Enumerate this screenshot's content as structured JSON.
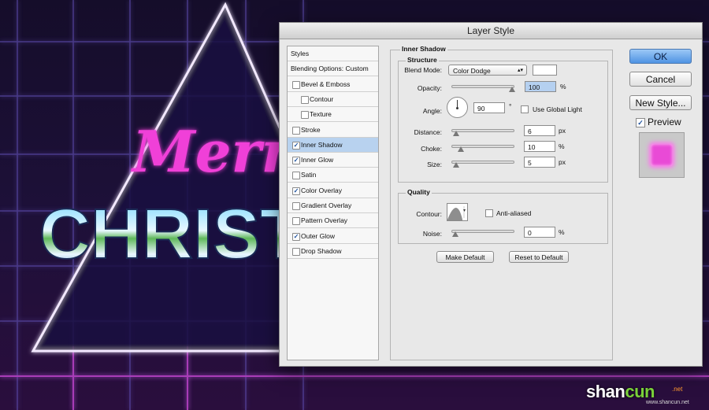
{
  "background_art": {
    "line1": "Merr",
    "line2": "CHRISTI"
  },
  "dialog": {
    "title": "Layer Style",
    "styles_list": [
      {
        "label": "Styles",
        "checkbox": false,
        "checked": false,
        "indent": 0,
        "selected": false
      },
      {
        "label": "Blending Options: Custom",
        "checkbox": false,
        "checked": false,
        "indent": 0,
        "selected": false
      },
      {
        "label": "Bevel & Emboss",
        "checkbox": true,
        "checked": false,
        "indent": 0,
        "selected": false
      },
      {
        "label": "Contour",
        "checkbox": true,
        "checked": false,
        "indent": 1,
        "selected": false
      },
      {
        "label": "Texture",
        "checkbox": true,
        "checked": false,
        "indent": 1,
        "selected": false
      },
      {
        "label": "Stroke",
        "checkbox": true,
        "checked": false,
        "indent": 0,
        "selected": false
      },
      {
        "label": "Inner Shadow",
        "checkbox": true,
        "checked": true,
        "indent": 0,
        "selected": true
      },
      {
        "label": "Inner Glow",
        "checkbox": true,
        "checked": true,
        "indent": 0,
        "selected": false
      },
      {
        "label": "Satin",
        "checkbox": true,
        "checked": false,
        "indent": 0,
        "selected": false
      },
      {
        "label": "Color Overlay",
        "checkbox": true,
        "checked": true,
        "indent": 0,
        "selected": false
      },
      {
        "label": "Gradient Overlay",
        "checkbox": true,
        "checked": false,
        "indent": 0,
        "selected": false
      },
      {
        "label": "Pattern Overlay",
        "checkbox": true,
        "checked": false,
        "indent": 0,
        "selected": false
      },
      {
        "label": "Outer Glow",
        "checkbox": true,
        "checked": true,
        "indent": 0,
        "selected": false
      },
      {
        "label": "Drop Shadow",
        "checkbox": true,
        "checked": false,
        "indent": 0,
        "selected": false
      }
    ],
    "panel": {
      "title": "Inner Shadow",
      "structure": {
        "title": "Structure",
        "blend_mode_label": "Blend Mode:",
        "blend_mode_value": "Color Dodge",
        "blend_color": "#ffffff",
        "opacity_label": "Opacity:",
        "opacity_value": "100",
        "opacity_unit": "%",
        "opacity_fraction": 1.0,
        "angle_label": "Angle:",
        "angle_value": "90",
        "angle_unit": "°",
        "use_global_light_label": "Use Global Light",
        "distance_label": "Distance:",
        "distance_value": "6",
        "distance_unit": "px",
        "distance_fraction": 0.02,
        "choke_label": "Choke:",
        "choke_value": "10",
        "choke_unit": "%",
        "choke_fraction": 0.1,
        "size_label": "Size:",
        "size_value": "5",
        "size_unit": "px",
        "size_fraction": 0.02
      },
      "quality": {
        "title": "Quality",
        "contour_label": "Contour:",
        "anti_aliased_label": "Anti-aliased",
        "noise_label": "Noise:",
        "noise_value": "0",
        "noise_unit": "%",
        "noise_fraction": 0.0
      },
      "make_default_label": "Make Default",
      "reset_default_label": "Reset to Default"
    },
    "buttons": {
      "ok": "OK",
      "cancel": "Cancel",
      "new_style": "New Style...",
      "preview_label": "Preview"
    },
    "colors": {
      "accent": "#4f93e3",
      "selection": "#b8d2ef",
      "preview_swatch": "#e94ad6"
    }
  },
  "watermark": {
    "shan": "shan",
    "cun": "cun",
    "net": ".net",
    "url": "www.shancun.net"
  }
}
